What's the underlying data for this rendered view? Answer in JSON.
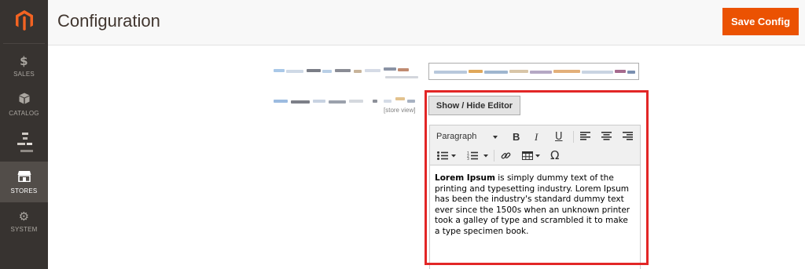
{
  "sidebar": {
    "items": [
      {
        "label": "SALES",
        "icon": "$"
      },
      {
        "label": "CATALOG",
        "icon": "catalog-icon"
      },
      {
        "label": "",
        "icon": "blurred-icon"
      },
      {
        "label": "STORES",
        "icon": "stores-icon",
        "active": true
      },
      {
        "label": "SYSTEM",
        "icon": "⚙"
      }
    ]
  },
  "header": {
    "title": "Configuration",
    "save_label": "Save Config",
    "accent_color": "#eb5202"
  },
  "form": {
    "scope_label": "[store view]"
  },
  "editor": {
    "toggle_label": "Show / Hide Editor",
    "block_format": "Paragraph",
    "content_bold": "Lorem Ipsum",
    "content_rest": " is simply dummy text of the printing and typesetting industry. Lorem Ipsum has been the industry's standard dummy text ever since the 1500s when an unknown printer took a galley of type and scrambled it to make a type specimen book."
  },
  "colors": {
    "sidebar": "#373330",
    "highlight_border": "#e22626"
  }
}
